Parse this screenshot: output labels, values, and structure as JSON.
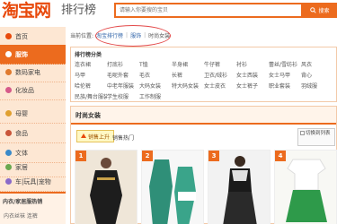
{
  "header": {
    "logo_text": "淘宝网",
    "logo_sub": "排行榜",
    "search_placeholder": "请输入你要搜的宝贝",
    "search_button": "搜索"
  },
  "sidebar": {
    "items": [
      {
        "label": "首页",
        "active": false
      },
      {
        "label": "服饰",
        "active": true
      },
      {
        "label": "数码家电",
        "active": false
      },
      {
        "label": "化妆品",
        "active": false
      },
      {
        "label": "母婴",
        "active": false
      },
      {
        "label": "食品",
        "active": false
      },
      {
        "label": "文体",
        "active": false
      },
      {
        "label": "家居",
        "active": false
      },
      {
        "label": "车|玩具|宠物",
        "active": false
      }
    ],
    "footer_title": "内衣/家居服热销",
    "footer_item": "内衣丝袜 连裤"
  },
  "breadcrumb": {
    "prefix": "当前位置:",
    "items": [
      "淘宝排行榜",
      "服饰",
      "时尚女装"
    ]
  },
  "categories": {
    "title": "排行榜分类",
    "items": [
      "连衣裙",
      "打底衫",
      "T恤",
      "半身裙",
      "牛仔裤",
      "衬衫",
      "蕾丝/雪纺衫",
      "风衣",
      "马甲",
      "毛呢外套",
      "毛衣",
      "长裤",
      "卫衣/绒衫",
      "女士西装",
      "女士马甲",
      "背心",
      "哈伦裤",
      "中老年服装",
      "大码女装",
      "特大码女装",
      "女士皮衣",
      "女士裤子",
      "职业套装",
      "羽绒服",
      "民族/舞台服装",
      "学生校服",
      "工作制服"
    ]
  },
  "ranking": {
    "title": "时尚女装",
    "tab_up": "销售上升",
    "tab_hot": "销售热门",
    "toggle_label": "切换到列表"
  },
  "products": {
    "items": [
      {
        "rank": "1"
      },
      {
        "rank": "2"
      },
      {
        "rank": "3"
      },
      {
        "rank": "4"
      }
    ]
  }
}
